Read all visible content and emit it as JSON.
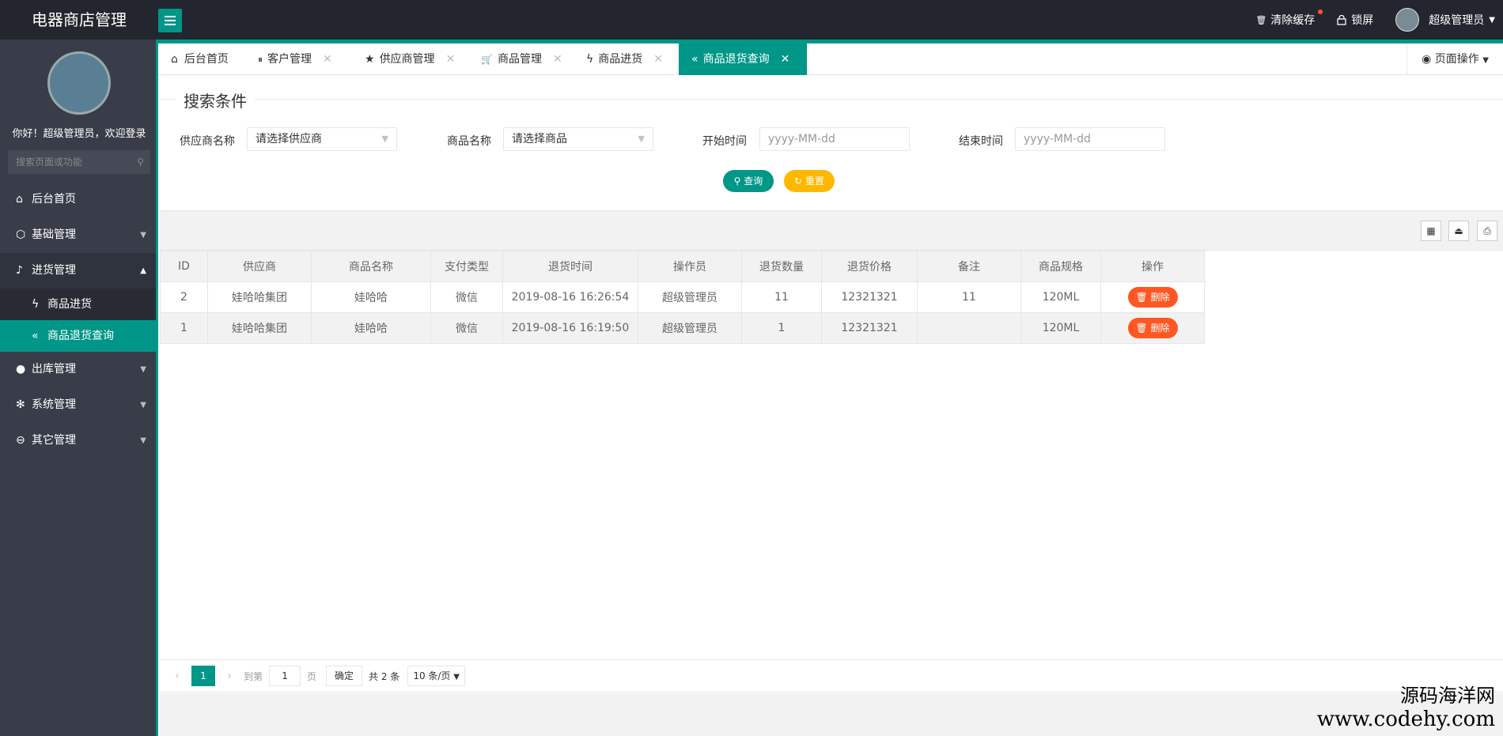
{
  "header": {
    "app_title": "电器商店管理",
    "clear_cache": "清除缓存",
    "lock_screen": "锁屏",
    "user_name": "超级管理员"
  },
  "sidebar": {
    "welcome": "你好！超级管理员，欢迎登录",
    "search_placeholder": "搜索页面或功能",
    "items": [
      {
        "label": "后台首页",
        "icon": "home-icon"
      },
      {
        "label": "基础管理",
        "icon": "cube-icon"
      },
      {
        "label": "进货管理",
        "icon": "speaker-icon"
      },
      {
        "label": "出库管理",
        "icon": "chat-icon"
      },
      {
        "label": "系统管理",
        "icon": "gear-icon"
      },
      {
        "label": "其它管理",
        "icon": "exit-icon"
      }
    ],
    "sub_items": [
      {
        "label": "商品进货",
        "icon": "fire-icon"
      },
      {
        "label": "商品退货查询",
        "icon": "double-left-icon"
      }
    ]
  },
  "tabs": [
    {
      "label": "后台首页"
    },
    {
      "label": "客户管理"
    },
    {
      "label": "供应商管理"
    },
    {
      "label": "商品管理"
    },
    {
      "label": "商品进货"
    },
    {
      "label": "商品退货查询"
    }
  ],
  "page_ops": "页面操作",
  "search": {
    "legend": "搜索条件",
    "supplier_label": "供应商名称",
    "supplier_value": "请选择供应商",
    "goods_label": "商品名称",
    "goods_value": "请选择商品",
    "start_label": "开始时间",
    "start_placeholder": "yyyy-MM-dd",
    "end_label": "结束时间",
    "end_placeholder": "yyyy-MM-dd",
    "query_button": "查询",
    "reset_button": "重置"
  },
  "table": {
    "headers": [
      "ID",
      "供应商",
      "商品名称",
      "支付类型",
      "退货时间",
      "操作员",
      "退货数量",
      "退货价格",
      "备注",
      "商品规格",
      "操作"
    ],
    "rows": [
      [
        "2",
        "娃哈哈集团",
        "娃哈哈",
        "微信",
        "2019-08-16 16:26:54",
        "超级管理员",
        "11",
        "12321321",
        "11",
        "120ML"
      ],
      [
        "1",
        "娃哈哈集团",
        "娃哈哈",
        "微信",
        "2019-08-16 16:19:50",
        "超级管理员",
        "1",
        "12321321",
        "",
        "120ML"
      ]
    ],
    "delete_label": "删除"
  },
  "pager": {
    "current_page": "1",
    "goto_label": "到第",
    "goto_value": "1",
    "page_unit": "页",
    "confirm": "确定",
    "total": "共 2 条",
    "page_size": "10 条/页"
  },
  "watermark": {
    "line1": "源码海洋网",
    "line2": "www.codehy.com"
  }
}
